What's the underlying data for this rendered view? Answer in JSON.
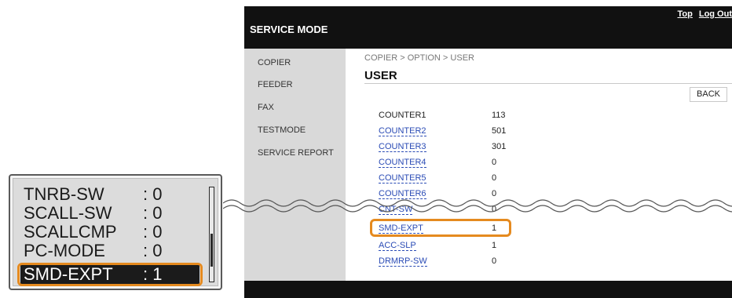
{
  "lcd": {
    "rows": [
      {
        "key": "TNRB-SW",
        "value": ": 0"
      },
      {
        "key": "SCALL-SW",
        "value": ": 0"
      },
      {
        "key": "SCALLCMP",
        "value": ": 0"
      },
      {
        "key": "PC-MODE",
        "value": ": 0"
      },
      {
        "key": "SMD-EXPT",
        "value": ": 1"
      }
    ],
    "selected_index": 4,
    "scroll_position": 0.75
  },
  "window": {
    "title": "SERVICE MODE",
    "links": {
      "top": "Top",
      "logout": "Log Out"
    },
    "sidebar": {
      "items": [
        {
          "label": "COPIER"
        },
        {
          "label": "FEEDER"
        },
        {
          "label": "FAX"
        },
        {
          "label": "TESTMODE"
        },
        {
          "label": "SERVICE REPORT"
        }
      ]
    },
    "breadcrumb": "COPIER > OPTION > USER",
    "page_title": "USER",
    "back_label": "BACK",
    "rows": [
      {
        "label": "COUNTER1",
        "value": "113"
      },
      {
        "label": "COUNTER2",
        "value": "501"
      },
      {
        "label": "COUNTER3",
        "value": "301"
      },
      {
        "label": "COUNTER4",
        "value": "0"
      },
      {
        "label": "COUNTER5",
        "value": "0"
      },
      {
        "label": "COUNTER6",
        "value": "0"
      },
      {
        "label": "CNT-SW",
        "value": "0"
      },
      {
        "label": "SMD-EXPT",
        "value": "1"
      },
      {
        "label": "ACC-SLP",
        "value": "1"
      },
      {
        "label": "DRMRP-SW",
        "value": "0"
      }
    ]
  },
  "colors": {
    "highlight": "#e58a1f",
    "link": "#2a4bb5",
    "header": "#111111",
    "sidebar": "#d9d9d9"
  }
}
